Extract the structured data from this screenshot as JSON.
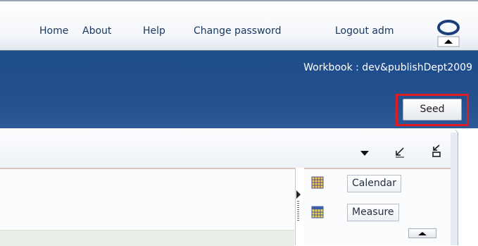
{
  "nav": {
    "home": "Home",
    "about": "About",
    "help": "Help",
    "change_password": "Change password",
    "logout": "Logout adm"
  },
  "workbook": {
    "label": "Workbook : dev&publishDept2009"
  },
  "seed": {
    "label": "Seed"
  },
  "panel": {
    "header_icons": [
      "chevron-down-icon",
      "minimize-icon",
      "detach-icon"
    ],
    "buttons": [
      {
        "label": "Calendar",
        "icon": "grid-icon"
      },
      {
        "label": "Measure",
        "icon": "grid-icon"
      }
    ]
  },
  "colors": {
    "band_blue": "#234f8c",
    "nav_text": "#19375f",
    "highlight_red": "#e21a22"
  }
}
